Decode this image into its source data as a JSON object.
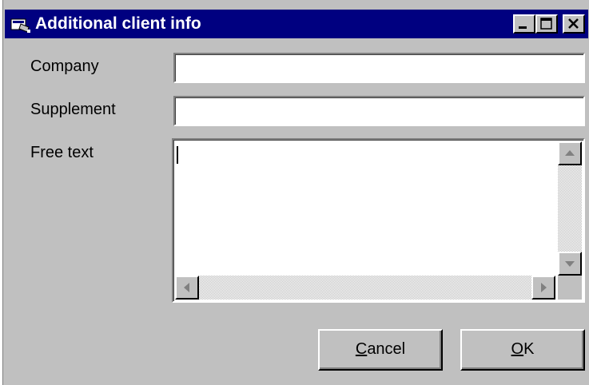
{
  "window": {
    "title": "Additional client info",
    "controls": {
      "minimize_icon": "minimize-icon",
      "maximize_icon": "maximize-icon",
      "close_icon": "close-icon"
    }
  },
  "form": {
    "company": {
      "label": "Company",
      "value": ""
    },
    "supplement": {
      "label": "Supplement",
      "value": ""
    },
    "free_text": {
      "label": "Free text",
      "value": ""
    }
  },
  "buttons": {
    "cancel": {
      "accel": "C",
      "rest": "ancel"
    },
    "ok": {
      "accel": "O",
      "rest": "K"
    }
  },
  "colors": {
    "titlebar": "#000080",
    "face": "#c0c0c0",
    "field": "#ffffff"
  }
}
